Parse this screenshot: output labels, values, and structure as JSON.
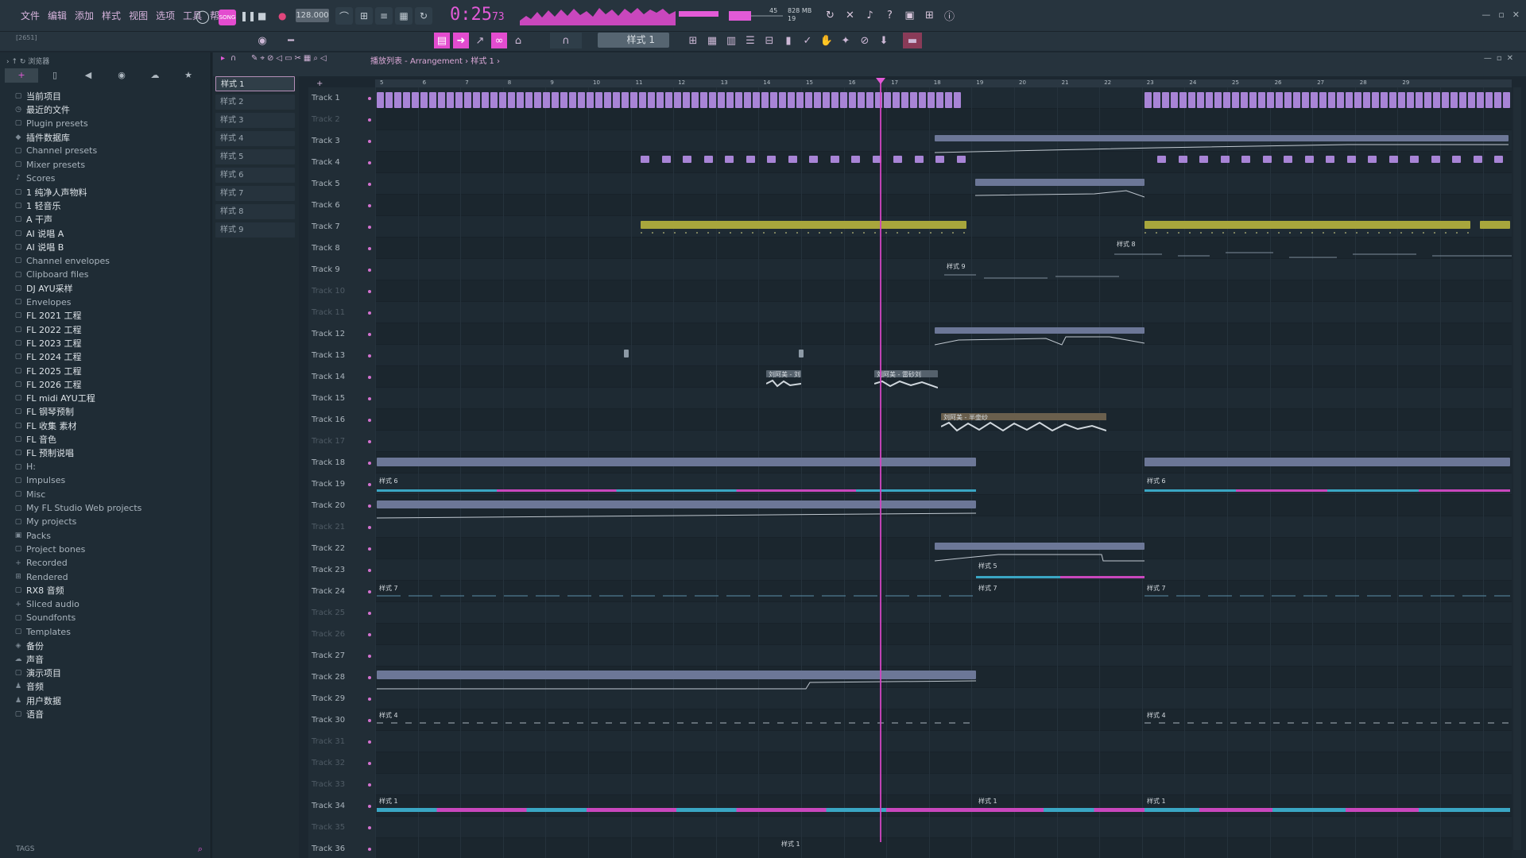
{
  "menu": [
    "文件",
    "编辑",
    "添加",
    "样式",
    "视图",
    "选项",
    "工具",
    "帮助"
  ],
  "transport": {
    "mode_label": "SONG",
    "tempo": "128.000",
    "time_main": "0:25",
    "time_sub": "73",
    "cpu_line1": "828 MB",
    "cpu_line2": "19",
    "cpu_value": "45"
  },
  "toolbar2": {
    "hint": "[2651]",
    "pattern_selector": "样式 1"
  },
  "browser": {
    "header": "浏览器",
    "tabs": [
      "+",
      "▯",
      "◀",
      "◉",
      "☁",
      "★"
    ],
    "items": [
      {
        "label": "当前项目",
        "icon": "folder-icon",
        "bright": true
      },
      {
        "label": "最近的文件",
        "icon": "clock-icon",
        "bright": true
      },
      {
        "label": "Plugin presets",
        "icon": "folder-icon",
        "bright": false
      },
      {
        "label": "插件数据库",
        "icon": "plugin-icon",
        "bright": true
      },
      {
        "label": "Channel presets",
        "icon": "folder-icon",
        "bright": false
      },
      {
        "label": "Mixer presets",
        "icon": "folder-icon",
        "bright": false
      },
      {
        "label": "Scores",
        "icon": "note-icon",
        "bright": false
      },
      {
        "label": "1 纯净人声物料",
        "icon": "folder-icon",
        "bright": true
      },
      {
        "label": "1 轻音乐",
        "icon": "folder-icon",
        "bright": true
      },
      {
        "label": "A 干声",
        "icon": "folder-icon",
        "bright": true
      },
      {
        "label": "AI 说唱 A",
        "icon": "folder-icon",
        "bright": true
      },
      {
        "label": "AI 说唱 B",
        "icon": "folder-icon",
        "bright": true
      },
      {
        "label": "Channel envelopes",
        "icon": "folder-icon",
        "bright": false
      },
      {
        "label": "Clipboard files",
        "icon": "folder-icon",
        "bright": false
      },
      {
        "label": "DJ AYU采样",
        "icon": "folder-icon",
        "bright": true
      },
      {
        "label": "Envelopes",
        "icon": "folder-icon",
        "bright": false
      },
      {
        "label": "FL 2021 工程",
        "icon": "folder-icon",
        "bright": true
      },
      {
        "label": "FL 2022 工程",
        "icon": "folder-icon",
        "bright": true
      },
      {
        "label": "FL 2023 工程",
        "icon": "folder-icon",
        "bright": true
      },
      {
        "label": "FL 2024 工程",
        "icon": "folder-icon",
        "bright": true
      },
      {
        "label": "FL 2025 工程",
        "icon": "folder-icon",
        "bright": true
      },
      {
        "label": "FL 2026 工程",
        "icon": "folder-icon",
        "bright": true
      },
      {
        "label": "FL midi AYU工程",
        "icon": "folder-icon",
        "bright": true
      },
      {
        "label": "FL 钢琴预制",
        "icon": "folder-icon",
        "bright": true
      },
      {
        "label": "FL 收集 素材",
        "icon": "folder-icon",
        "bright": true
      },
      {
        "label": "FL 音色",
        "icon": "folder-icon",
        "bright": true
      },
      {
        "label": "FL 预制说唱",
        "icon": "folder-icon",
        "bright": true
      },
      {
        "label": "H:",
        "icon": "folder-icon",
        "bright": false
      },
      {
        "label": "Impulses",
        "icon": "folder-icon",
        "bright": false
      },
      {
        "label": "Misc",
        "icon": "folder-icon",
        "bright": false
      },
      {
        "label": "My FL Studio Web projects",
        "icon": "folder-icon",
        "bright": false
      },
      {
        "label": "My projects",
        "icon": "folder-icon",
        "bright": false
      },
      {
        "label": "Packs",
        "icon": "box-icon",
        "bright": false
      },
      {
        "label": "Project bones",
        "icon": "folder-icon",
        "bright": false
      },
      {
        "label": "Recorded",
        "icon": "plus-icon",
        "bright": false
      },
      {
        "label": "Rendered",
        "icon": "render-icon",
        "bright": false
      },
      {
        "label": "RX8 音频",
        "icon": "folder-icon",
        "bright": true
      },
      {
        "label": "Sliced audio",
        "icon": "plus-icon",
        "bright": false
      },
      {
        "label": "Soundfonts",
        "icon": "folder-icon",
        "bright": false
      },
      {
        "label": "Templates",
        "icon": "folder-icon",
        "bright": false
      },
      {
        "label": "备份",
        "icon": "backup-icon",
        "bright": true
      },
      {
        "label": "声音",
        "icon": "cloud-icon",
        "bright": true
      },
      {
        "label": "演示项目",
        "icon": "folder-icon",
        "bright": true
      },
      {
        "label": "音频",
        "icon": "person-icon",
        "bright": true
      },
      {
        "label": "用户数据",
        "icon": "person-icon",
        "bright": true
      },
      {
        "label": "语音",
        "icon": "folder-icon",
        "bright": true
      }
    ],
    "tags_label": "TAGS"
  },
  "picker": [
    "样式 1",
    "样式 2",
    "样式 3",
    "样式 4",
    "样式 5",
    "样式 6",
    "样式 7",
    "样式 8",
    "样式 9"
  ],
  "playlist": {
    "title": "播放列表 - Arrangement › 样式 1 ›",
    "ruler": [
      "5",
      "6",
      "7",
      "8",
      "9",
      "10",
      "11",
      "12",
      "13",
      "14",
      "15",
      "16",
      "17",
      "18",
      "19",
      "20",
      "21",
      "22",
      "23",
      "24",
      "25",
      "26",
      "27",
      "28",
      "29"
    ],
    "tracks": [
      "Track 1",
      "Track 2",
      "Track 3",
      "Track 4",
      "Track 5",
      "Track 6",
      "Track 7",
      "Track 8",
      "Track 9",
      "Track 10",
      "Track 11",
      "Track 12",
      "Track 13",
      "Track 14",
      "Track 15",
      "Track 16",
      "Track 17",
      "Track 18",
      "Track 19",
      "Track 20",
      "Track 21",
      "Track 22",
      "Track 23",
      "Track 24",
      "Track 25",
      "Track 26",
      "Track 27",
      "Track 28",
      "Track 29",
      "Track 30",
      "Track 31",
      "Track 32",
      "Track 33",
      "Track 34",
      "Track 35",
      "Track 36"
    ],
    "dim_tracks": [
      2,
      10,
      11,
      17,
      21,
      25,
      26,
      31,
      32,
      33,
      35
    ],
    "clip_labels": {
      "c8": "样式 8",
      "c9": "样式 9",
      "c14a": "刘阿美 - 刘",
      "c14b": "刘阿美 - 雷砂刘",
      "c16": "刘阿美 - 半壶纱",
      "c19a": "样式 6",
      "c19b": "样式 6",
      "c23": "样式 5",
      "c24a": "样式 7",
      "c24b": "样式 7",
      "c24c": "样式 7",
      "c30a": "样式 4",
      "c30b": "样式 4",
      "c34a": "样式 1",
      "c34b": "样式 1",
      "c34c": "样式 1",
      "c36": "样式 1"
    }
  },
  "colors": {
    "accent": "#e25ad7",
    "clip_purple": "#a884d6",
    "clip_olive": "#a8a63c",
    "clip_slate": "#6f7b9c",
    "clip_cyan": "#3aa6c4",
    "background": "#1c2730"
  }
}
